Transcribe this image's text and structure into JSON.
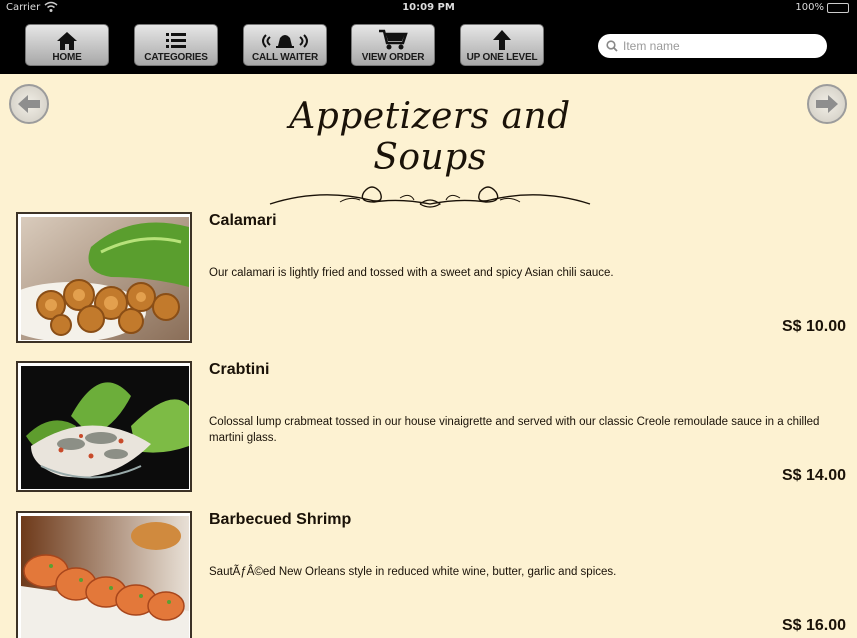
{
  "status_bar": {
    "carrier": "Carrier",
    "time": "10:09 PM",
    "battery": "100%"
  },
  "toolbar": {
    "buttons": [
      {
        "label": "HOME",
        "icon": "home-icon"
      },
      {
        "label": "CATEGORIES",
        "icon": "list-icon"
      },
      {
        "label": "CALL WAITER",
        "icon": "bell-icon"
      },
      {
        "label": "VIEW ORDER",
        "icon": "cart-icon"
      },
      {
        "label": "UP ONE LEVEL",
        "icon": "arrow-up-icon"
      }
    ],
    "search_placeholder": "Item name"
  },
  "page": {
    "title": "Appetizers and Soups"
  },
  "items": [
    {
      "name": "Calamari",
      "description": "Our calamari is lightly fried and tossed with a sweet and spicy Asian chili sauce.",
      "price": "S$ 10.00"
    },
    {
      "name": "Crabtini",
      "description": "Colossal lump crabmeat tossed in our house vinaigrette and served with our classic Creole remoulade sauce in a chilled martini glass.",
      "price": "S$ 14.00"
    },
    {
      "name": "Barbecued Shrimp",
      "description": "SautÃƒÂ©ed New Orleans style in reduced white wine, butter, garlic and spices.",
      "price": "S$ 16.00"
    }
  ]
}
